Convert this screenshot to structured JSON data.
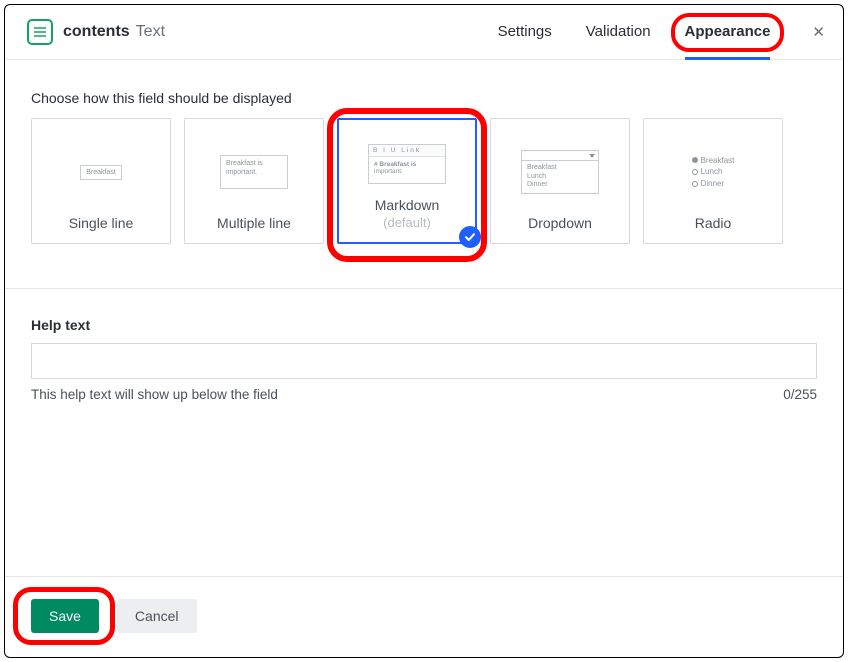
{
  "header": {
    "field_name": "contents",
    "field_type": "Text",
    "tabs": {
      "settings": "Settings",
      "validation": "Validation",
      "appearance": "Appearance"
    },
    "active_tab": "appearance"
  },
  "appearance": {
    "prompt": "Choose how this field should be displayed",
    "options": [
      {
        "id": "single-line",
        "label": "Single line",
        "preview": {
          "kind": "input",
          "text": "Breakfast"
        }
      },
      {
        "id": "multiple-line",
        "label": "Multiple line",
        "preview": {
          "kind": "textarea",
          "text": "Breakfast is important."
        }
      },
      {
        "id": "markdown",
        "label": "Markdown",
        "sublabel": "(default)",
        "selected": true,
        "preview": {
          "kind": "markdown",
          "toolbar": "B  I  U  Link",
          "line1": "# Breakfast is",
          "line2": "important."
        }
      },
      {
        "id": "dropdown",
        "label": "Dropdown",
        "preview": {
          "kind": "select",
          "items": [
            "Breakfast",
            "Lunch",
            "Dinner"
          ]
        }
      },
      {
        "id": "radio",
        "label": "Radio",
        "preview": {
          "kind": "radio",
          "items": [
            "Breakfast",
            "Lunch",
            "Dinner"
          ],
          "checked": 0
        }
      }
    ]
  },
  "help": {
    "label": "Help text",
    "value": "",
    "hint": "This help text will show up below the field",
    "counter": "0/255"
  },
  "footer": {
    "save": "Save",
    "cancel": "Cancel"
  },
  "annotations": {
    "highlighted": [
      "appearance-tab",
      "markdown-option",
      "save-button"
    ]
  }
}
